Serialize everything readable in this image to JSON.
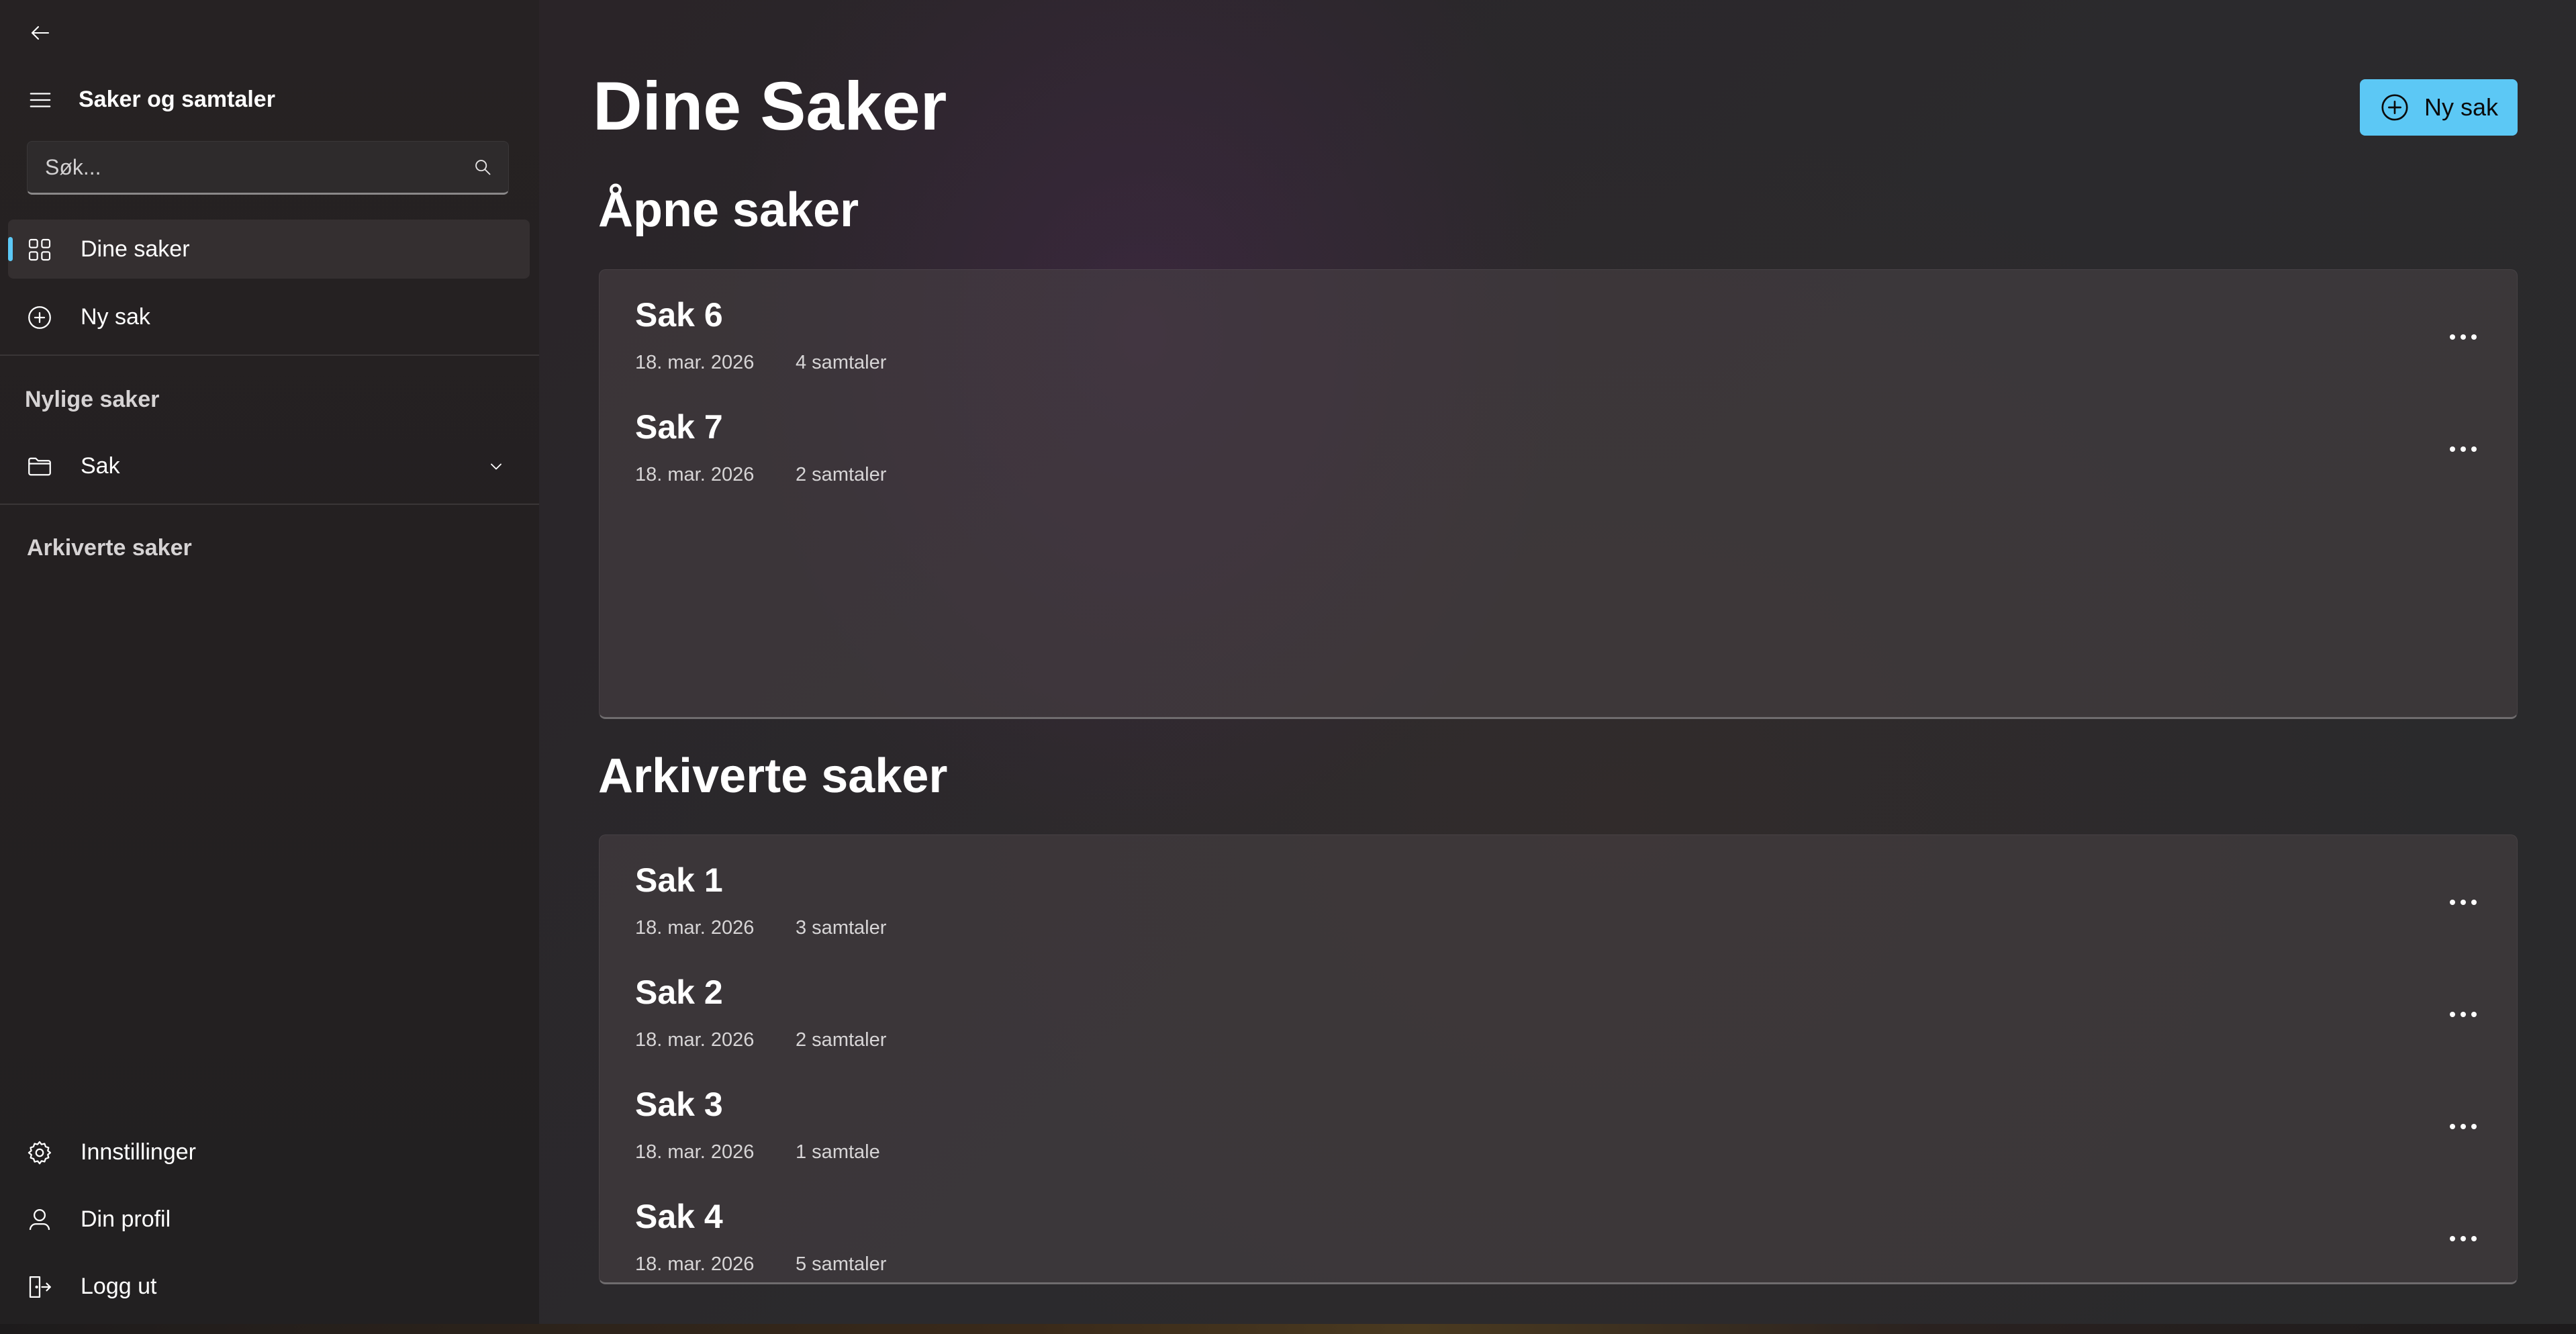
{
  "sidebar": {
    "title": "Saker og samtaler",
    "search": {
      "placeholder": "Søk...",
      "value": ""
    },
    "nav": [
      {
        "label": "Dine saker",
        "icon": "grid-icon",
        "selected": true
      },
      {
        "label": "Ny sak",
        "icon": "plus-circle-icon",
        "selected": false
      }
    ],
    "recent_heading": "Nylige saker",
    "recent_folder": {
      "label": "Sak",
      "icon": "folder-icon",
      "expanded": false
    },
    "archived_heading": "Arkiverte saker",
    "footer": [
      {
        "label": "Innstillinger",
        "icon": "gear-icon"
      },
      {
        "label": "Din profil",
        "icon": "person-icon"
      },
      {
        "label": "Logg ut",
        "icon": "sign-out-icon"
      }
    ]
  },
  "main": {
    "title": "Dine Saker",
    "new_button_label": "Ny sak",
    "open_section": {
      "heading": "Åpne saker",
      "items": [
        {
          "name": "Sak 6",
          "date": "18. mar. 2026",
          "count": "4 samtaler"
        },
        {
          "name": "Sak 7",
          "date": "18. mar. 2026",
          "count": "2 samtaler"
        }
      ]
    },
    "archived_section": {
      "heading": "Arkiverte saker",
      "items": [
        {
          "name": "Sak 1",
          "date": "18. mar. 2026",
          "count": "3 samtaler"
        },
        {
          "name": "Sak 2",
          "date": "18. mar. 2026",
          "count": "2 samtaler"
        },
        {
          "name": "Sak 3",
          "date": "18. mar. 2026",
          "count": "1 samtale"
        },
        {
          "name": "Sak 4",
          "date": "18. mar. 2026",
          "count": "5 samtaler"
        }
      ]
    }
  },
  "colors": {
    "accent": "#5cc8f5",
    "sidebar_bg": "#242021",
    "card_bg": "#484246",
    "text_primary": "#ffffff",
    "text_secondary": "#d7d5d6"
  }
}
